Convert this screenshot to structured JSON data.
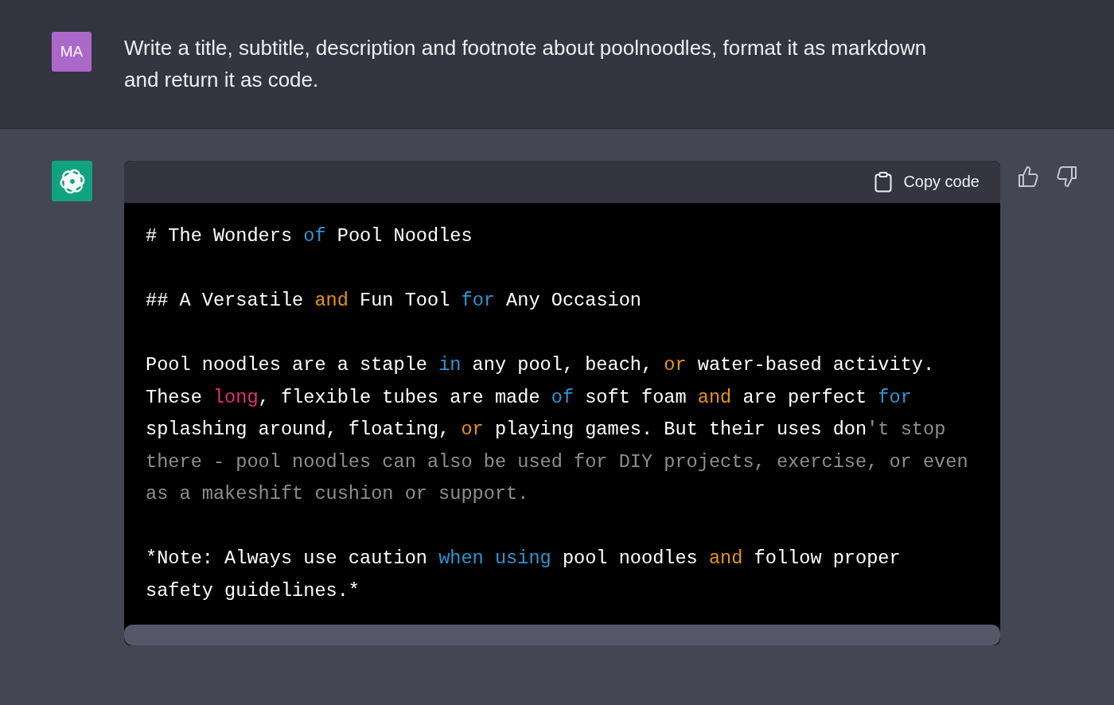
{
  "user_message": {
    "avatar": "MA",
    "text": "Write a title, subtitle, description and footnote about poolnoodles, format it as markdown and return it as code."
  },
  "assistant_message": {
    "code_block": {
      "copy_button": "Copy code",
      "lines": [
        {
          "kind": "code",
          "tokens": [
            {
              "kind": "plain",
              "text": "# The Wonders "
            },
            {
              "kind": "keyword",
              "text": "of"
            },
            {
              "kind": "plain",
              "text": " Pool Noodles"
            }
          ]
        },
        {
          "kind": "blank"
        },
        {
          "kind": "code",
          "tokens": [
            {
              "kind": "plain",
              "text": "## A Versatile "
            },
            {
              "kind": "operator",
              "text": "and"
            },
            {
              "kind": "plain",
              "text": " Fun Tool "
            },
            {
              "kind": "keyword",
              "text": "for"
            },
            {
              "kind": "plain",
              "text": " Any Occasion"
            }
          ]
        },
        {
          "kind": "blank"
        },
        {
          "kind": "code",
          "tokens": [
            {
              "kind": "plain",
              "text": "Pool noodles are a staple "
            },
            {
              "kind": "keyword",
              "text": "in"
            },
            {
              "kind": "plain",
              "text": " any pool, beach, "
            },
            {
              "kind": "operator",
              "text": "or"
            },
            {
              "kind": "plain",
              "text": " water-based activity."
            }
          ]
        },
        {
          "kind": "code",
          "tokens": [
            {
              "kind": "plain",
              "text": "These "
            },
            {
              "kind": "literal",
              "text": "long"
            },
            {
              "kind": "plain",
              "text": ", flexible tubes are made "
            },
            {
              "kind": "keyword",
              "text": "of"
            },
            {
              "kind": "plain",
              "text": " soft foam "
            },
            {
              "kind": "operator",
              "text": "and"
            },
            {
              "kind": "plain",
              "text": " are perfect "
            },
            {
              "kind": "keyword",
              "text": "for"
            }
          ]
        },
        {
          "kind": "code",
          "tokens": [
            {
              "kind": "plain",
              "text": "splashing around, floating, "
            },
            {
              "kind": "operator",
              "text": "or"
            },
            {
              "kind": "plain",
              "text": " playing games. But their uses don"
            },
            {
              "kind": "string",
              "text": "'t stop"
            }
          ]
        },
        {
          "kind": "code",
          "tokens": [
            {
              "kind": "string",
              "text": "there - pool noodles can also be used for DIY projects, exercise, or even"
            }
          ]
        },
        {
          "kind": "code",
          "tokens": [
            {
              "kind": "string",
              "text": "as a makeshift cushion or support."
            }
          ]
        },
        {
          "kind": "blank"
        },
        {
          "kind": "code",
          "tokens": [
            {
              "kind": "plain",
              "text": "*Note: Always use caution "
            },
            {
              "kind": "keyword",
              "text": "when using"
            },
            {
              "kind": "plain",
              "text": " pool noodles "
            },
            {
              "kind": "operator",
              "text": "and"
            },
            {
              "kind": "plain",
              "text": " follow proper"
            }
          ]
        },
        {
          "kind": "code",
          "tokens": [
            {
              "kind": "plain",
              "text": "safety guidelines.*"
            }
          ]
        }
      ]
    }
  }
}
